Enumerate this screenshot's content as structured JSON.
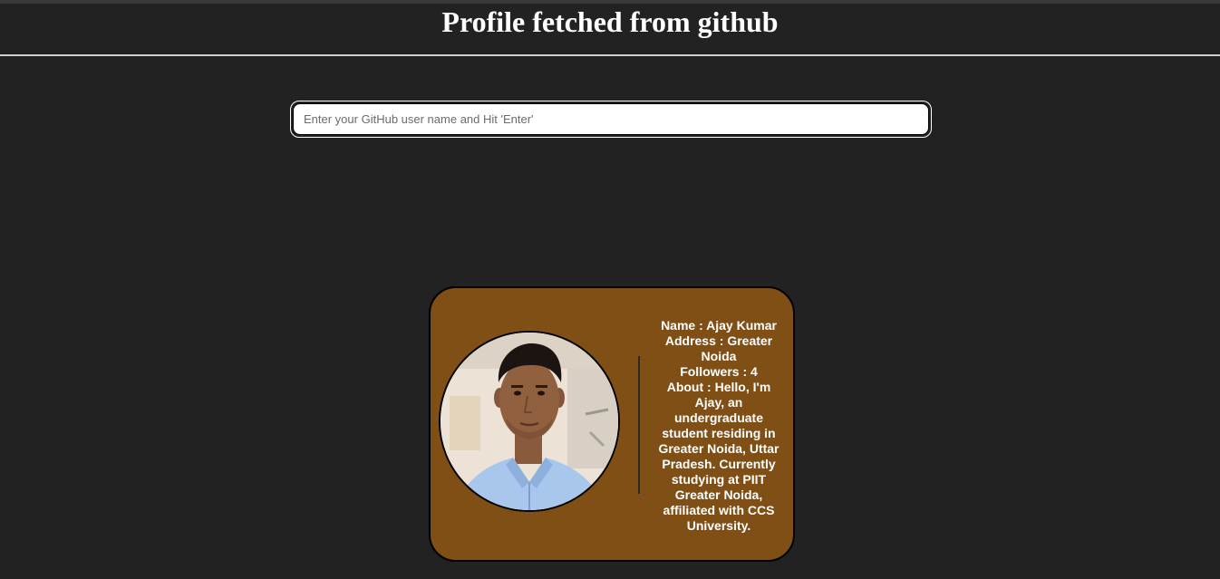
{
  "header": {
    "title": "Profile fetched from github"
  },
  "search": {
    "placeholder": "Enter your GitHub user name and Hit 'Enter'",
    "value": ""
  },
  "profile": {
    "name": "Name : Ajay Kumar",
    "address": "Address : Greater Noida",
    "followers": "Followers : 4",
    "about": "About : Hello, I'm Ajay, an undergraduate student residing in Greater Noida, Uttar Pradesh. Currently studying at PIIT Greater Noida, affiliated with CCS University."
  },
  "colors": {
    "background": "#222222",
    "card": "#7f4f16",
    "text": "#ffffff"
  }
}
